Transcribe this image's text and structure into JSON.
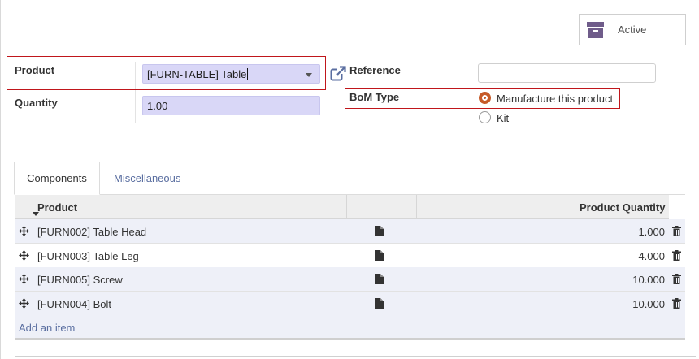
{
  "active_button": {
    "label": "Active",
    "icon": "archive-icon"
  },
  "form": {
    "product_label": "Product",
    "product_value": "[FURN-TABLE] Table",
    "quantity_label": "Quantity",
    "quantity_value": "1.00",
    "reference_label": "Reference",
    "reference_value": "",
    "bom_type_label": "BoM Type",
    "bom_type_options": [
      {
        "label": "Manufacture this product",
        "selected": true
      },
      {
        "label": "Kit",
        "selected": false
      }
    ]
  },
  "tabs": [
    {
      "label": "Components",
      "active": true
    },
    {
      "label": "Miscellaneous",
      "active": false
    }
  ],
  "table": {
    "columns": {
      "product": "Product",
      "quantity": "Product Quantity"
    },
    "rows": [
      {
        "product": "[FURN002] Table Head",
        "quantity": "1.000"
      },
      {
        "product": "[FURN003] Table Leg",
        "quantity": "4.000"
      },
      {
        "product": "[FURN005] Screw",
        "quantity": "10.000"
      },
      {
        "product": "[FURN004] Bolt",
        "quantity": "10.000"
      }
    ],
    "add_item_label": "Add an item"
  },
  "colors": {
    "accent_radio": "#c65a28",
    "highlight_box": "#c0161b",
    "link": "#5a6ea0",
    "field_bg": "#d9d7f7"
  }
}
